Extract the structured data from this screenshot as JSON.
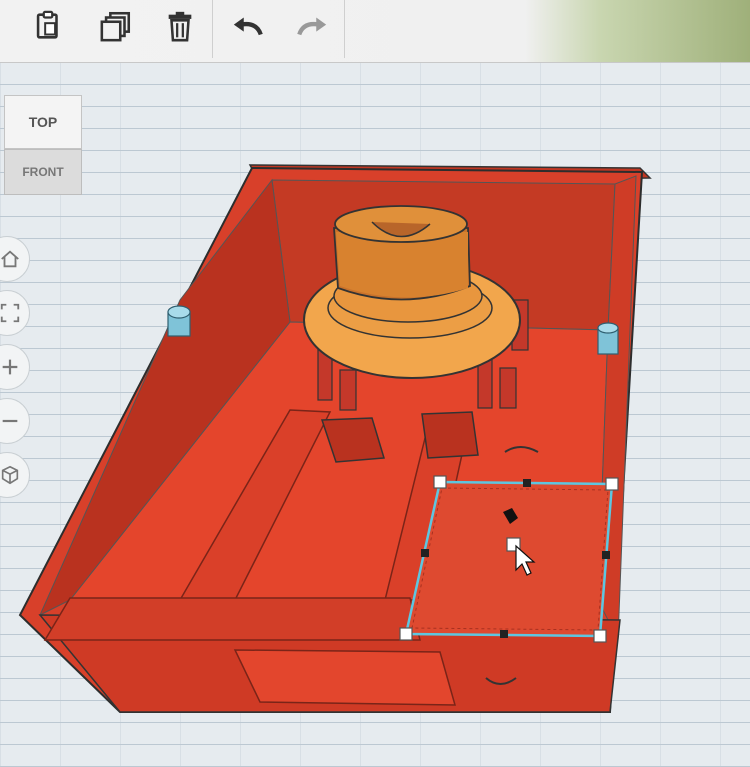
{
  "toolbar": {
    "items": [
      {
        "name": "paste",
        "icon": "clipboard-icon"
      },
      {
        "name": "duplicate",
        "icon": "duplicate-icon"
      },
      {
        "name": "delete",
        "icon": "trash-icon"
      },
      {
        "name": "undo",
        "icon": "undo-icon"
      },
      {
        "name": "redo",
        "icon": "redo-icon"
      }
    ]
  },
  "viewcube": {
    "top_label": "TOP",
    "front_label": "FRONT"
  },
  "nav_controls": [
    {
      "name": "home-view",
      "icon": "home-icon"
    },
    {
      "name": "fit-view",
      "icon": "fit-view-icon"
    },
    {
      "name": "zoom-in",
      "icon": "plus-icon"
    },
    {
      "name": "zoom-out",
      "icon": "minus-icon"
    },
    {
      "name": "perspective",
      "icon": "cube-icon"
    }
  ],
  "colors": {
    "box_red": "#d8402a",
    "box_dark": "#9c2a1a",
    "cylinder_orange": "#e7963c",
    "peg_blue": "#7fc3d8",
    "selection_blue": "#5ec6e0"
  }
}
